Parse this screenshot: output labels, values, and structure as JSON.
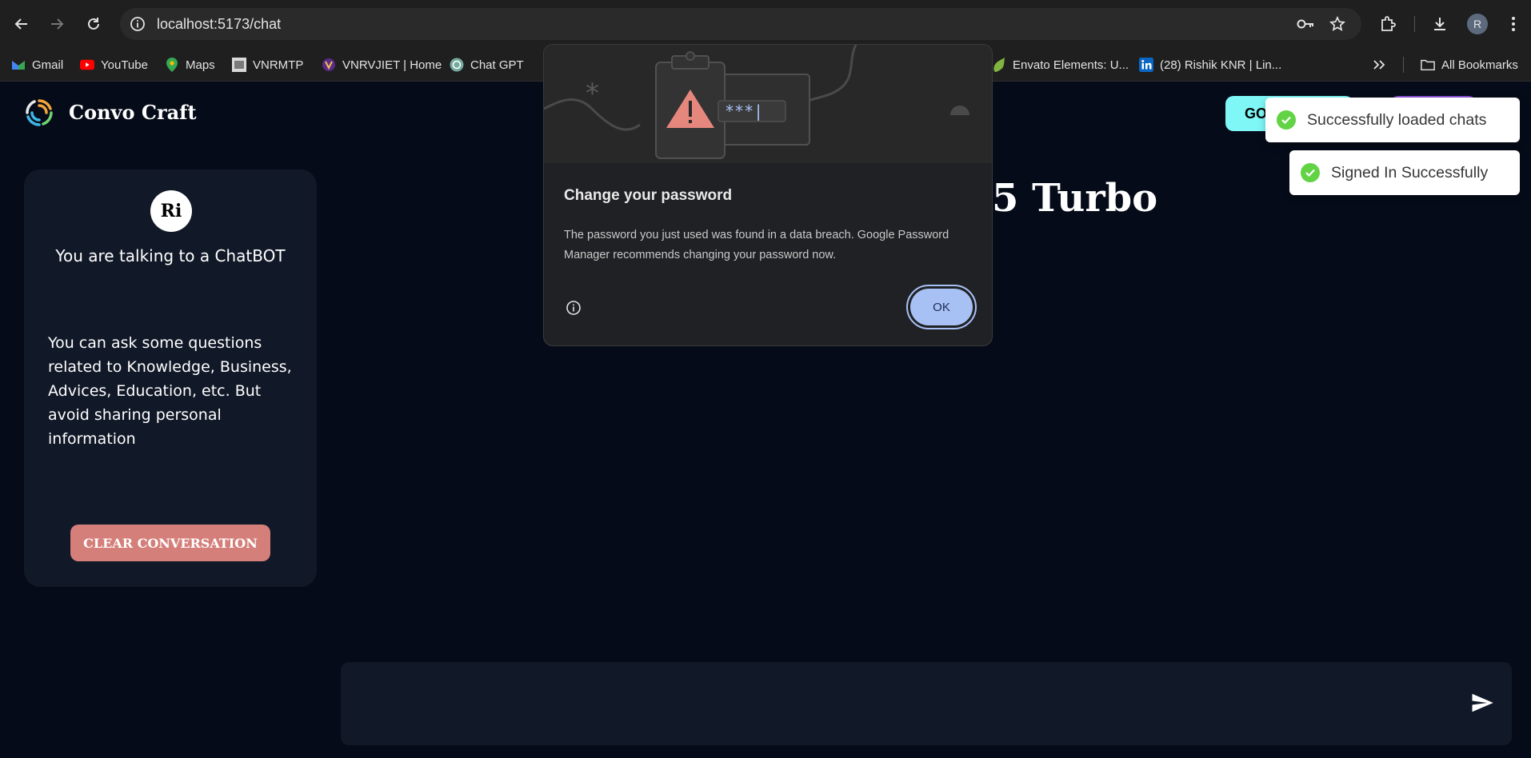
{
  "browser": {
    "url": "localhost:5173/chat",
    "profile_initial": "R",
    "bookmarks": [
      {
        "label": "Gmail",
        "icon": "gmail-icon"
      },
      {
        "label": "YouTube",
        "icon": "youtube-icon"
      },
      {
        "label": "Maps",
        "icon": "maps-icon"
      },
      {
        "label": "VNRMTP",
        "icon": "vnrmtp-icon"
      },
      {
        "label": "VNRVJIET | Home",
        "icon": "vnrvjiet-icon"
      },
      {
        "label": "Chat GPT",
        "icon": "chatgpt-icon"
      },
      {
        "label": "Envato Elements: U...",
        "icon": "envato-icon"
      },
      {
        "label": "(28) Rishik KNR | Lin...",
        "icon": "linkedin-icon"
      }
    ],
    "all_bookmarks": "All Bookmarks"
  },
  "app": {
    "brand": "Convo Craft",
    "header_button": "GO",
    "model_title_visible": "5 Turbo"
  },
  "sidebar": {
    "avatar": "Ri",
    "talking": "You are talking to a ChatBOT",
    "hint": "You can ask some questions related to Knowledge, Business, Advices, Education, etc. But avoid sharing personal information",
    "clear_button": "CLEAR CONVERSATION"
  },
  "composer": {
    "placeholder": ""
  },
  "dialog": {
    "title": "Change your password",
    "body": "The password you just used was found in a data breach. Google Password Manager recommends changing your password now.",
    "ok": "OK",
    "illustration_text": "***|"
  },
  "toasts": [
    {
      "text": "Successfully loaded chats"
    },
    {
      "text": "Signed In Successfully"
    }
  ]
}
